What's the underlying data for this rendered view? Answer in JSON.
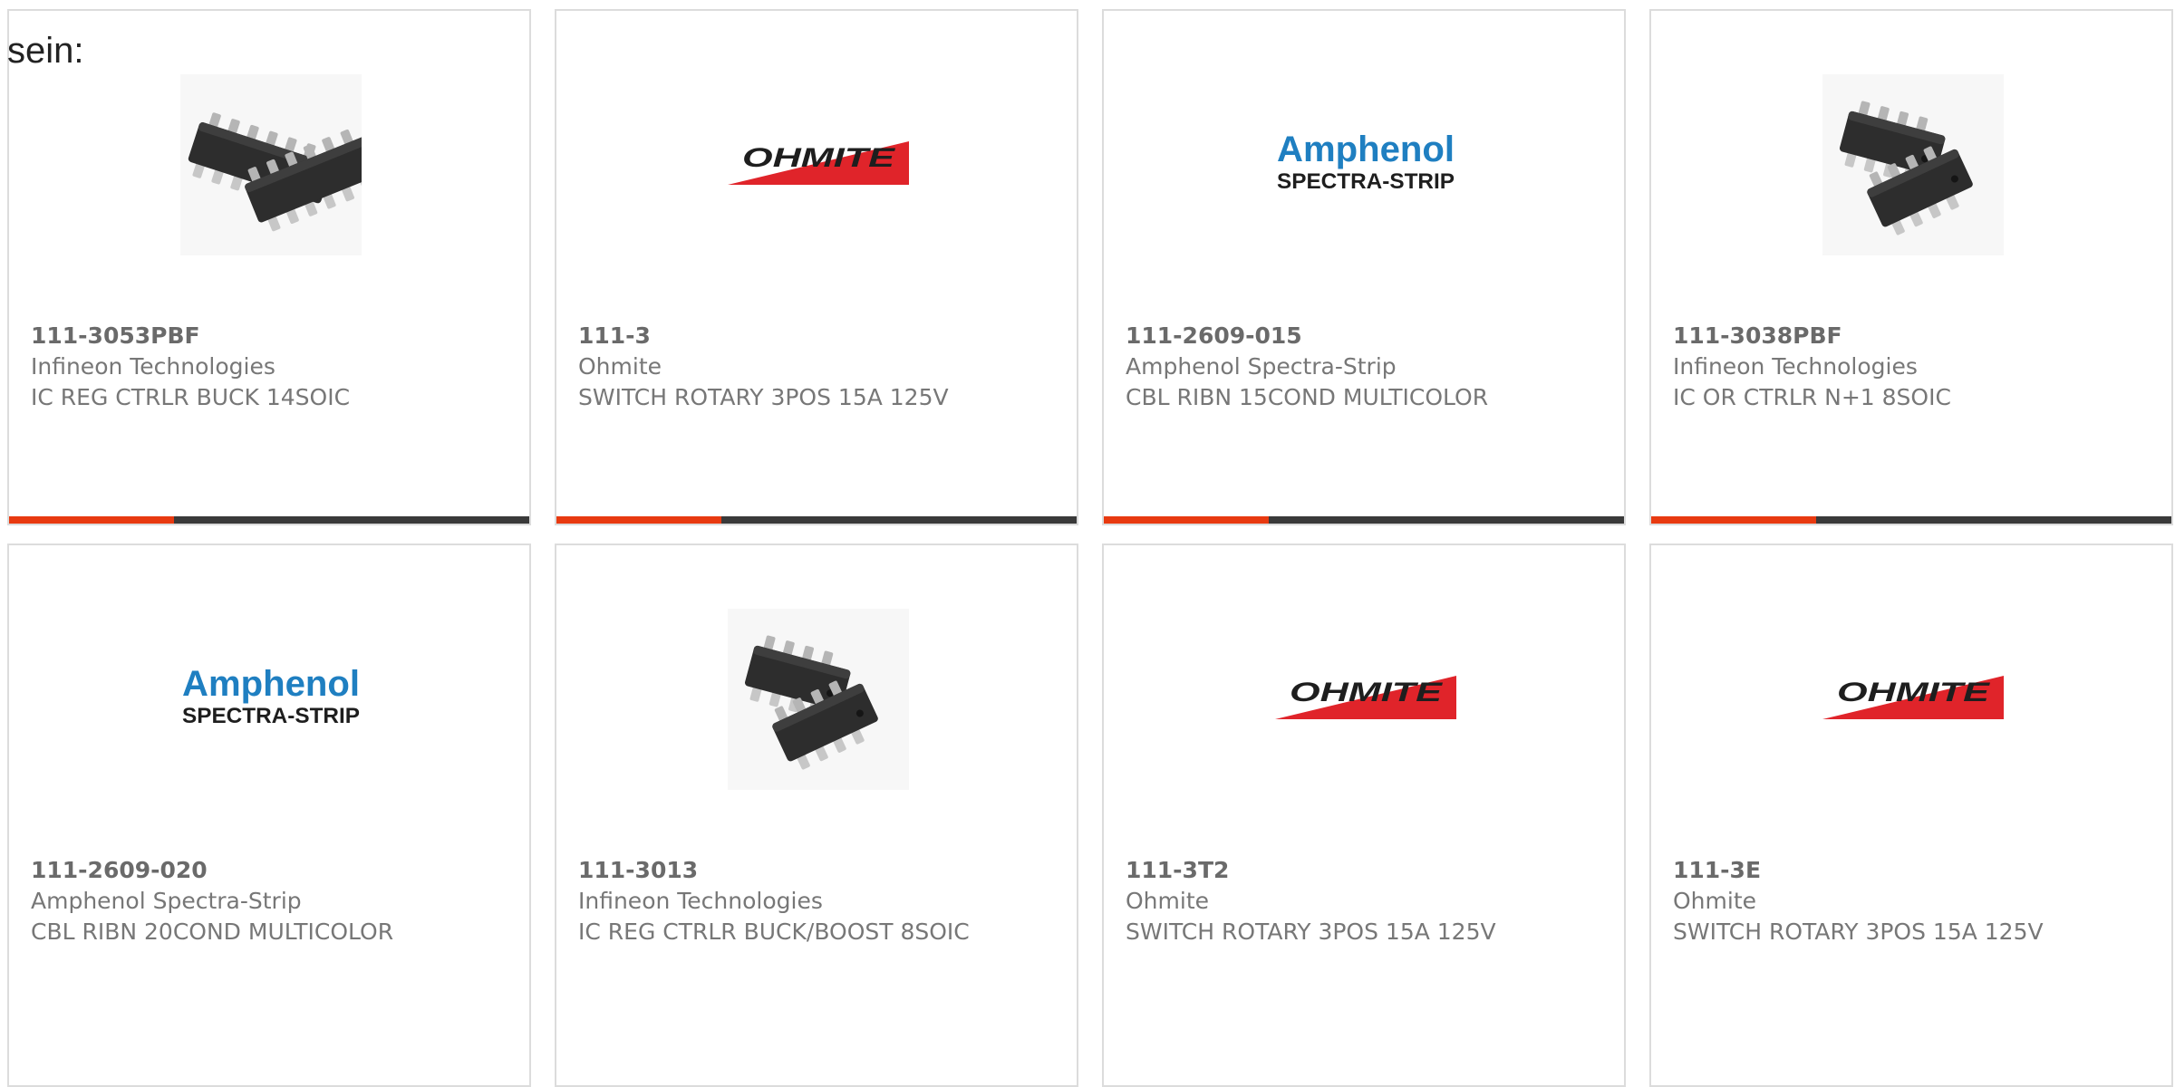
{
  "intro": {
    "label": "sein:"
  },
  "colors": {
    "accent": "#e83a10",
    "bar": "#3a3a3a",
    "card_border": "#dcdcdc",
    "text": "#777777"
  },
  "products": [
    {
      "part_number": "111-3053PBF",
      "manufacturer": "Infineon Technologies",
      "description": "IC REG CTRLR BUCK 14SOIC",
      "image": "soic-14-chip"
    },
    {
      "part_number": "111-3",
      "manufacturer": "Ohmite",
      "description": "SWITCH ROTARY 3POS 15A 125V",
      "image": "ohmite-logo",
      "logo_text": "OHMITE"
    },
    {
      "part_number": "111-2609-015",
      "manufacturer": "Amphenol Spectra-Strip",
      "description": "CBL RIBN 15COND MULTICOLOR",
      "image": "amphenol-logo",
      "logo_text": "Amphenol",
      "logo_subtext": "SPECTRA-STRIP"
    },
    {
      "part_number": "111-3038PBF",
      "manufacturer": "Infineon Technologies",
      "description": "IC OR CTRLR N+1 8SOIC",
      "image": "soic-8-chip"
    },
    {
      "part_number": "111-2609-020",
      "manufacturer": "Amphenol Spectra-Strip",
      "description": "CBL RIBN 20COND MULTICOLOR",
      "image": "amphenol-logo",
      "logo_text": "Amphenol",
      "logo_subtext": "SPECTRA-STRIP"
    },
    {
      "part_number": "111-3013",
      "manufacturer": "Infineon Technologies",
      "description": "IC REG CTRLR BUCK/BOOST 8SOIC",
      "image": "soic-8-chip"
    },
    {
      "part_number": "111-3T2",
      "manufacturer": "Ohmite",
      "description": "SWITCH ROTARY 3POS 15A 125V",
      "image": "ohmite-logo",
      "logo_text": "OHMITE"
    },
    {
      "part_number": "111-3E",
      "manufacturer": "Ohmite",
      "description": "SWITCH ROTARY 3POS 15A 125V",
      "image": "ohmite-logo",
      "logo_text": "OHMITE"
    }
  ]
}
